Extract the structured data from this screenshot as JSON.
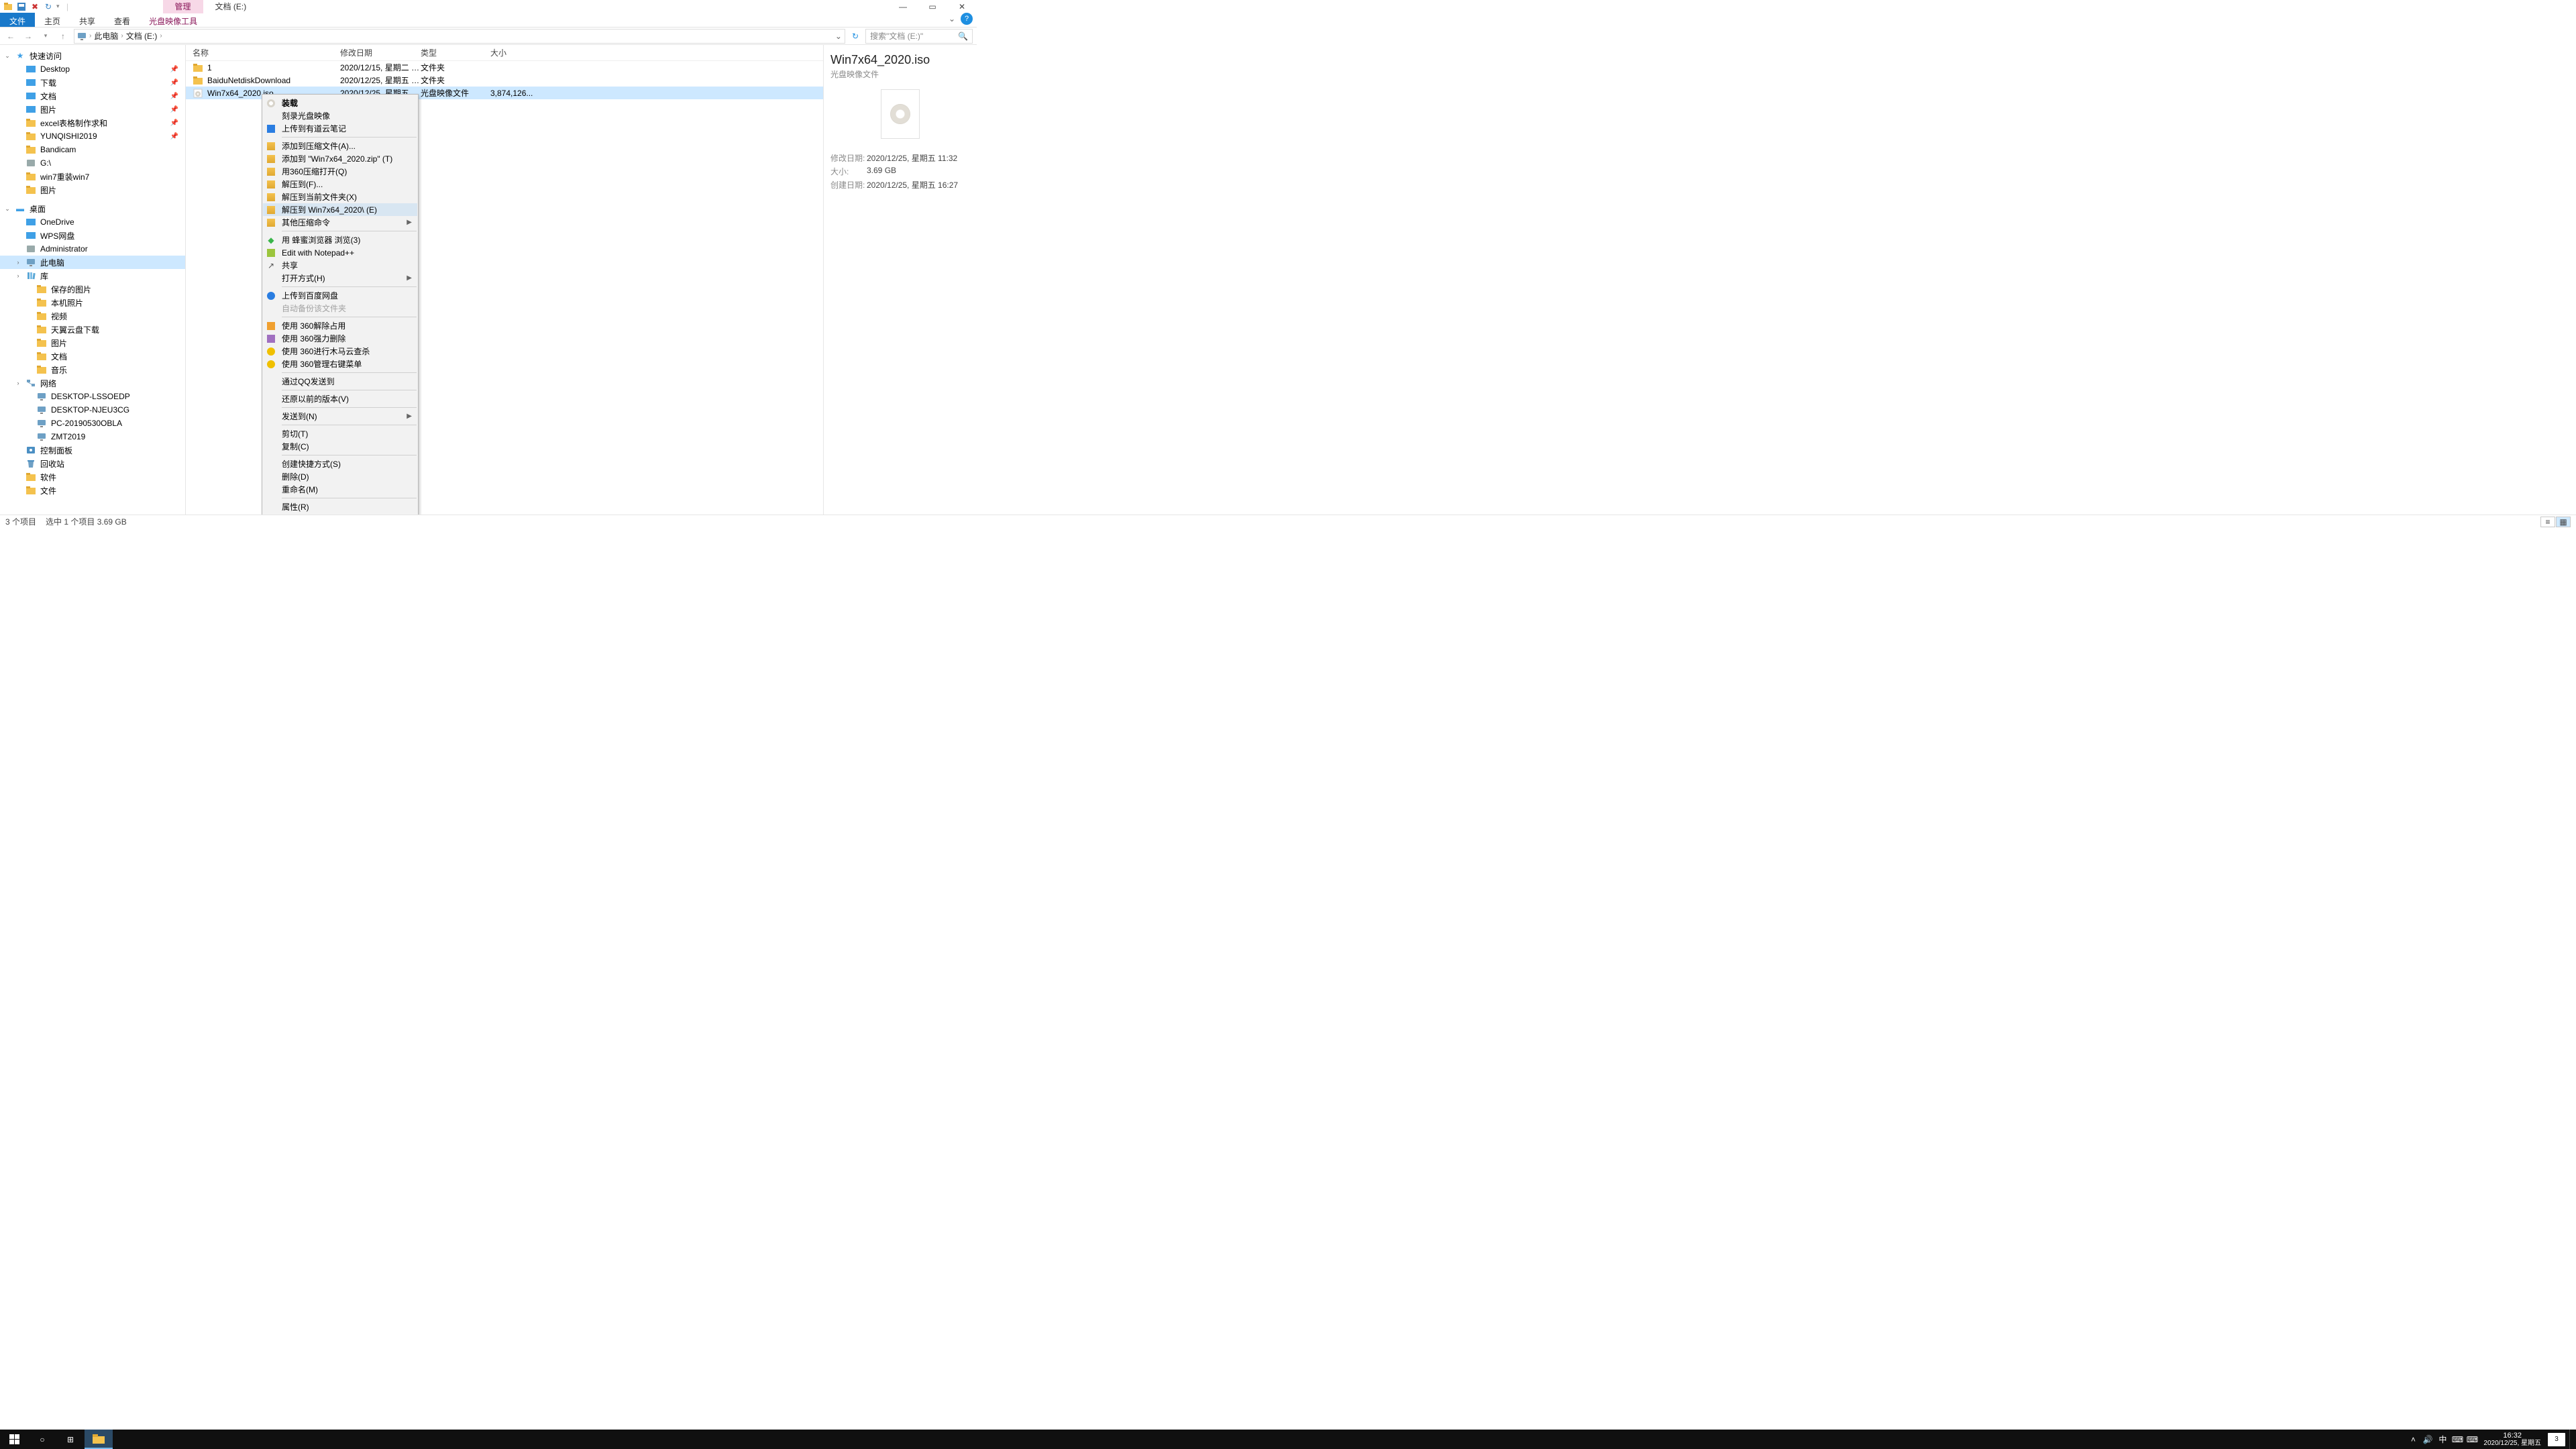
{
  "title_tabs": {
    "manage": "管理",
    "path": "文档 (E:)"
  },
  "window": {
    "help": "?"
  },
  "ribbon": {
    "file": "文件",
    "home": "主页",
    "share": "共享",
    "view": "查看",
    "disc": "光盘映像工具"
  },
  "address": {
    "crumbs": [
      "此电脑",
      "文档 (E:)"
    ],
    "search_placeholder": "搜索\"文档 (E:)\""
  },
  "nav": {
    "quick": "快速访问",
    "items_quick": [
      {
        "label": "Desktop",
        "pin": true,
        "ic": "blue"
      },
      {
        "label": "下载",
        "pin": true,
        "ic": "blue"
      },
      {
        "label": "文档",
        "pin": true,
        "ic": "blue"
      },
      {
        "label": "图片",
        "pin": true,
        "ic": "blue"
      },
      {
        "label": "excel表格制作求和",
        "pin": true,
        "ic": "folder"
      },
      {
        "label": "YUNQISHI2019",
        "pin": true,
        "ic": "folder"
      },
      {
        "label": "Bandicam",
        "pin": false,
        "ic": "folder"
      },
      {
        "label": "G:\\",
        "pin": false,
        "ic": "gray"
      },
      {
        "label": "win7重装win7",
        "pin": false,
        "ic": "folder"
      },
      {
        "label": "图片",
        "pin": false,
        "ic": "folder"
      }
    ],
    "desktop": "桌面",
    "items_desktop": [
      {
        "label": "OneDrive",
        "ic": "blue"
      },
      {
        "label": "WPS网盘",
        "ic": "blue"
      },
      {
        "label": "Administrator",
        "ic": "gray"
      },
      {
        "label": "此电脑",
        "ic": "pc"
      },
      {
        "label": "库",
        "ic": "lib"
      },
      {
        "label": "保存的图片",
        "ic": "folder",
        "depth": 3
      },
      {
        "label": "本机照片",
        "ic": "folder",
        "depth": 3
      },
      {
        "label": "视频",
        "ic": "folder",
        "depth": 3
      },
      {
        "label": "天翼云盘下载",
        "ic": "folder",
        "depth": 3
      },
      {
        "label": "图片",
        "ic": "folder",
        "depth": 3
      },
      {
        "label": "文档",
        "ic": "folder",
        "depth": 3
      },
      {
        "label": "音乐",
        "ic": "folder",
        "depth": 3
      },
      {
        "label": "网络",
        "ic": "net"
      },
      {
        "label": "DESKTOP-LSSOEDP",
        "ic": "pc",
        "depth": 3
      },
      {
        "label": "DESKTOP-NJEU3CG",
        "ic": "pc",
        "depth": 3
      },
      {
        "label": "PC-20190530OBLA",
        "ic": "pc",
        "depth": 3
      },
      {
        "label": "ZMT2019",
        "ic": "pc",
        "depth": 3
      },
      {
        "label": "控制面板",
        "ic": "ctrl"
      },
      {
        "label": "回收站",
        "ic": "recycle"
      },
      {
        "label": "软件",
        "ic": "folder"
      },
      {
        "label": "文件",
        "ic": "folder"
      }
    ]
  },
  "cols": {
    "name": "名称",
    "mod": "修改日期",
    "type": "类型",
    "size": "大小"
  },
  "rows": [
    {
      "name": "1",
      "mod": "2020/12/15, 星期二 1...",
      "type": "文件夹",
      "size": "",
      "ic": "folder"
    },
    {
      "name": "BaiduNetdiskDownload",
      "mod": "2020/12/25, 星期五 1...",
      "type": "文件夹",
      "size": "",
      "ic": "folder"
    },
    {
      "name": "Win7x64_2020.iso",
      "mod": "2020/12/25, 星期五 1...",
      "type": "光盘映像文件",
      "size": "3,874,126...",
      "ic": "iso",
      "selected": true
    }
  ],
  "context_menu": [
    {
      "label": "装载",
      "ic": "disc",
      "bold": true
    },
    {
      "label": "刻录光盘映像"
    },
    {
      "label": "上传到有道云笔记",
      "ic": "blue-sq"
    },
    {
      "sep": true
    },
    {
      "label": "添加到压缩文件(A)...",
      "ic": "zip"
    },
    {
      "label": "添加到 \"Win7x64_2020.zip\" (T)",
      "ic": "zip"
    },
    {
      "label": "用360压缩打开(Q)",
      "ic": "zip"
    },
    {
      "label": "解压到(F)...",
      "ic": "zip"
    },
    {
      "label": "解压到当前文件夹(X)",
      "ic": "zip"
    },
    {
      "label": "解压到 Win7x64_2020\\ (E)",
      "ic": "zip",
      "highlight": true
    },
    {
      "label": "其他压缩命令",
      "ic": "zip",
      "sub": true
    },
    {
      "sep": true
    },
    {
      "label": "用 蜂蜜浏览器 浏览(3)",
      "ic": "green-dot"
    },
    {
      "label": "Edit with Notepad++",
      "ic": "npp"
    },
    {
      "label": "共享",
      "ic": "share"
    },
    {
      "label": "打开方式(H)",
      "sub": true
    },
    {
      "sep": true
    },
    {
      "label": "上传到百度网盘",
      "ic": "baidu"
    },
    {
      "label": "自动备份该文件夹",
      "disabled": true
    },
    {
      "sep": true
    },
    {
      "label": "使用 360解除占用",
      "ic": "360o"
    },
    {
      "label": "使用 360强力删除",
      "ic": "360p"
    },
    {
      "label": "使用 360进行木马云查杀",
      "ic": "360y"
    },
    {
      "label": "使用 360管理右键菜单",
      "ic": "360y"
    },
    {
      "sep": true
    },
    {
      "label": "通过QQ发送到"
    },
    {
      "sep": true
    },
    {
      "label": "还原以前的版本(V)"
    },
    {
      "sep": true
    },
    {
      "label": "发送到(N)",
      "sub": true
    },
    {
      "sep": true
    },
    {
      "label": "剪切(T)"
    },
    {
      "label": "复制(C)"
    },
    {
      "sep": true
    },
    {
      "label": "创建快捷方式(S)"
    },
    {
      "label": "删除(D)"
    },
    {
      "label": "重命名(M)"
    },
    {
      "sep": true
    },
    {
      "label": "属性(R)"
    }
  ],
  "details": {
    "title": "Win7x64_2020.iso",
    "subtitle": "光盘映像文件",
    "mod_label": "修改日期:",
    "mod_val": "2020/12/25, 星期五 11:32",
    "size_label": "大小:",
    "size_val": "3.69 GB",
    "create_label": "创建日期:",
    "create_val": "2020/12/25, 星期五 16:27"
  },
  "status": {
    "count": "3 个项目",
    "selection": "选中 1 个项目  3.69 GB"
  },
  "taskbar": {
    "ime": "中",
    "time": "16:32",
    "date": "2020/12/25, 星期五",
    "notif": "3"
  }
}
